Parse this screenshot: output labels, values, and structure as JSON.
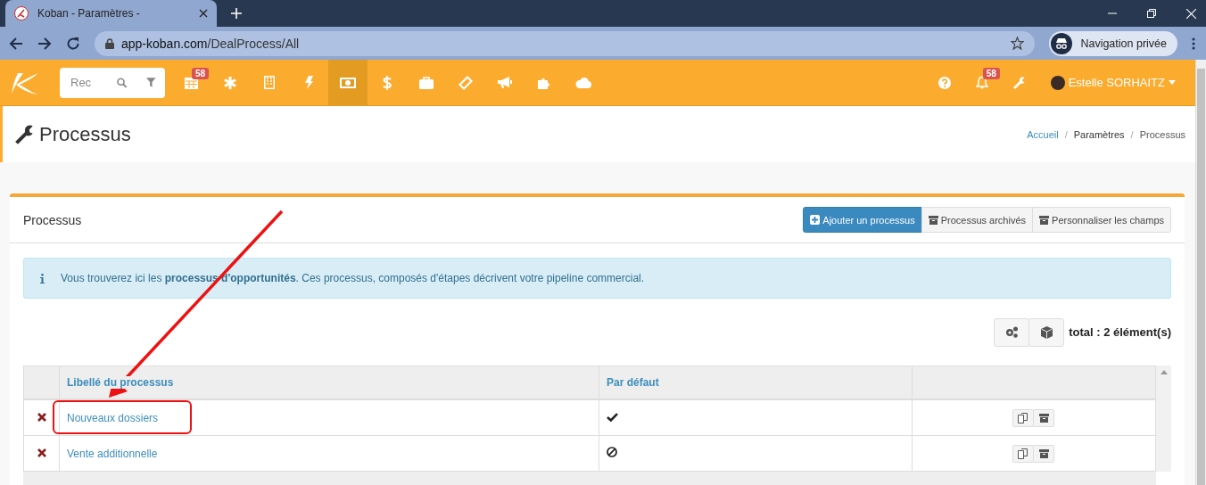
{
  "browser": {
    "tab_title": "Koban - Paramètres -",
    "url_host": "app-koban.com",
    "url_path": "/DealProcess/All",
    "profile": "Navigation privée"
  },
  "nav": {
    "search_placeholder": "Rec",
    "items": [
      {
        "kind": "calendar",
        "badge": "58",
        "selected": false
      },
      {
        "kind": "asterisk",
        "selected": false
      },
      {
        "kind": "building",
        "selected": false
      },
      {
        "kind": "bolt",
        "selected": false
      },
      {
        "kind": "money",
        "selected": true
      },
      {
        "kind": "dollar",
        "selected": false
      },
      {
        "kind": "briefcase",
        "selected": false
      },
      {
        "kind": "ticket",
        "selected": false
      },
      {
        "kind": "bullhorn",
        "selected": false
      },
      {
        "kind": "puzzle",
        "selected": false
      },
      {
        "kind": "cloud",
        "selected": false
      }
    ],
    "notifications_badge": "58",
    "user": "Estelle SORHAITZ"
  },
  "page": {
    "title": "Processus",
    "breadcrumb_separator": "/",
    "breadcrumb": [
      {
        "label": "Accueil",
        "kind": "link"
      },
      {
        "label": "Paramètres",
        "kind": "text"
      },
      {
        "label": "Processus",
        "kind": "current"
      }
    ]
  },
  "panel": {
    "title": "Processus",
    "buttons": [
      {
        "label": "Ajouter un processus",
        "kind": "primary"
      },
      {
        "label": "Processus archivés",
        "kind": "default"
      },
      {
        "label": "Personnaliser les champs",
        "kind": "default"
      }
    ],
    "info": "Vous trouverez ici les **processus d'opportunités**. Ces processus, composés d'étapes décrivent votre pipeline commercial.",
    "total": "total : 2 élément(s)",
    "table": {
      "columns": [
        "Libellé du processus",
        "Par défaut"
      ],
      "rows": [
        {
          "name": "Nouveaux dossiers",
          "default": true
        },
        {
          "name": "Vente additionnelle",
          "default": false
        }
      ]
    }
  }
}
